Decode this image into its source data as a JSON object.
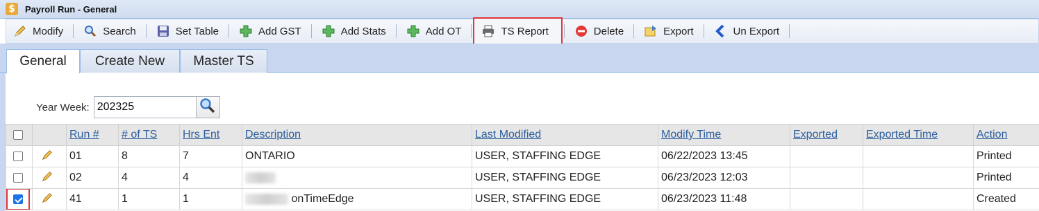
{
  "window": {
    "title": "Payroll Run - General",
    "app_icon": "dollar-icon",
    "app_icon_glyph": "$"
  },
  "toolbar": {
    "buttons": [
      {
        "label": "Modify",
        "icon": "pencil-icon"
      },
      {
        "label": "Search",
        "icon": "magnifier-icon"
      },
      {
        "label": "Set Table",
        "icon": "floppy-disk-icon"
      },
      {
        "label": "Add GST",
        "icon": "green-plus-icon"
      },
      {
        "label": "Add Stats",
        "icon": "green-plus-icon"
      },
      {
        "label": "Add OT",
        "icon": "green-plus-icon"
      },
      {
        "label": "TS Report",
        "icon": "printer-icon"
      },
      {
        "label": "Delete",
        "icon": "red-minus-icon"
      },
      {
        "label": "Export",
        "icon": "export-package-icon"
      },
      {
        "label": "Un Export",
        "icon": "blue-chevron-left-icon"
      }
    ],
    "highlighted": "TS Report"
  },
  "tabs": [
    {
      "label": "General",
      "active": true
    },
    {
      "label": "Create New",
      "active": false
    },
    {
      "label": "Master TS",
      "active": false
    }
  ],
  "filter": {
    "label": "Year Week:",
    "value": "202325",
    "search_icon": "magnifier-icon"
  },
  "grid": {
    "columns": [
      "Run #",
      "# of TS",
      "Hrs Ent",
      "Description",
      "Last Modified",
      "Modify Time",
      "Exported",
      "Exported Time",
      "Action"
    ],
    "rows": [
      {
        "checked": false,
        "run": "01",
        "ts": "8",
        "hrs": "7",
        "description": "ONTARIO",
        "last_modified": "USER, STAFFING EDGE",
        "modify_time": "06/22/2023 13:45",
        "exported": "",
        "exported_time": "",
        "action": "Printed"
      },
      {
        "checked": false,
        "run": "02",
        "ts": "4",
        "hrs": "4",
        "description": "",
        "last_modified": "USER, STAFFING EDGE",
        "modify_time": "06/23/2023 12:03",
        "exported": "",
        "exported_time": "",
        "action": "Printed"
      },
      {
        "checked": true,
        "run": "41",
        "ts": "1",
        "hrs": "1",
        "description": "onTimeEdge",
        "last_modified": "USER, STAFFING EDGE",
        "modify_time": "06/23/2023 11:48",
        "exported": "",
        "exported_time": "",
        "action": "Created"
      }
    ]
  },
  "colors": {
    "accent_blue": "#2d5e9e",
    "highlight_red": "#e0363d",
    "tab_bg": "#c8d7ef"
  }
}
